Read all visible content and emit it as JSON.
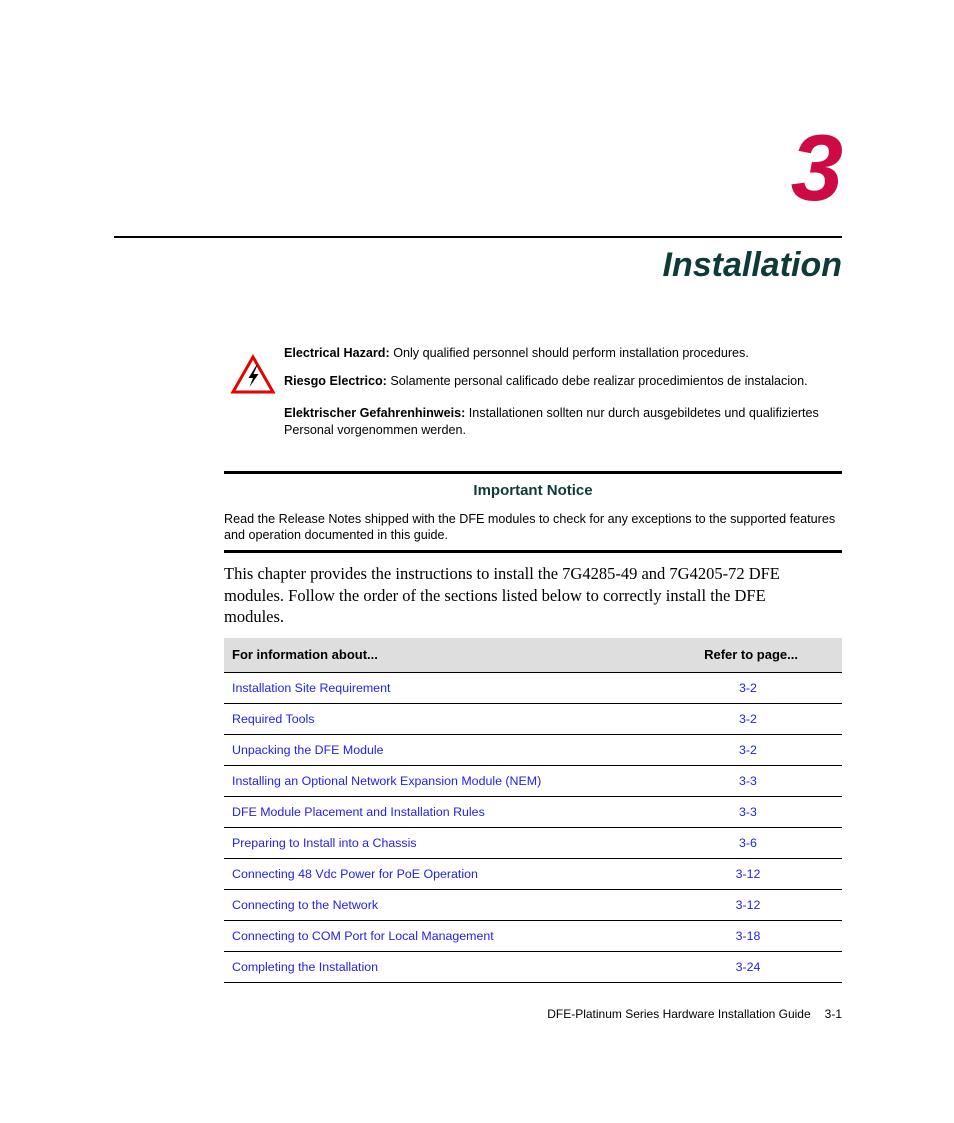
{
  "chapter": {
    "number": "3",
    "title": "Installation",
    "number_color": "#ce0a45",
    "title_color": "#0e3b38"
  },
  "warning": {
    "icon": "electrical-hazard-triangle-icon",
    "icon_triangle_color": "#e60000",
    "icon_bolt_color": "#000000",
    "paragraphs": [
      {
        "label": "Electrical Hazard:",
        "text": " Only qualified personnel should perform installation procedures."
      },
      {
        "label": "Riesgo Electrico:",
        "text": " Solamente personal calificado debe realizar procedimientos de instalacion."
      },
      {
        "label": "Elektrischer Gefahrenhinweis:",
        "text": " Installationen sollten nur durch ausgebildetes und qualifiziertes Personal vorgenommen werden."
      }
    ]
  },
  "notice": {
    "heading": "Important Notice",
    "heading_color": "#0e3b38",
    "body": "Read the Release Notes shipped with the DFE modules to check for any exceptions to the supported features and operation documented in this guide."
  },
  "intro": {
    "text": "This chapter provides the instructions to install the 7G4285-49 and 7G4205-72 DFE modules. Follow the order of the sections listed below to correctly install the DFE modules."
  },
  "summary_table": {
    "header_background": "#dedede",
    "link_color": "#2222e8",
    "columns": [
      "For information about...",
      "Refer to page..."
    ],
    "rows": [
      {
        "topic": "Installation Site Requirement",
        "page": "3-2"
      },
      {
        "topic": "Required Tools",
        "page": "3-2"
      },
      {
        "topic": "Unpacking the DFE Module",
        "page": "3-2"
      },
      {
        "topic": "Installing an Optional Network Expansion Module (NEM)",
        "page": "3-3"
      },
      {
        "topic": "DFE Module Placement and Installation Rules",
        "page": "3-3"
      },
      {
        "topic": "Preparing to Install into a Chassis",
        "page": "3-6"
      },
      {
        "topic": "Connecting 48 Vdc Power for PoE Operation",
        "page": "3-12"
      },
      {
        "topic": "Connecting to the Network",
        "page": "3-12"
      },
      {
        "topic": "Connecting to COM Port for Local Management",
        "page": "3-18"
      },
      {
        "topic": "Completing the Installation",
        "page": "3-24"
      }
    ]
  },
  "footer": {
    "guide_title": "DFE-Platinum Series Hardware Installation Guide",
    "page_number": "3-1"
  }
}
